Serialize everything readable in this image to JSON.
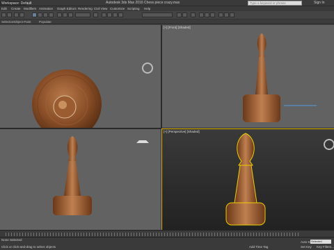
{
  "titlebar": {
    "workspace": "Workspace: Default",
    "app_title": "Autodesk 3ds Max 2016",
    "file": "Chess piece crazy.max",
    "search_placeholder": "Type a keyword or phrase",
    "signin": "Sign In"
  },
  "menus": [
    "Edit",
    "Create",
    "Modifiers",
    "Animation",
    "Graph Editors",
    "Rendering",
    "Civil View",
    "Customize",
    "Scripting",
    "Help"
  ],
  "ribbon": [
    "Selection",
    "Object Paint",
    "Populate"
  ],
  "viewports": {
    "top": "",
    "front": "[+] [Front] [Shaded]",
    "left": "",
    "perspective": "[+] [Perspective] [Shaded]"
  },
  "status": {
    "selected": "None Selected",
    "hint": "Click or click-and-drag to select objects",
    "welcome": "Welcome to M",
    "add_time_tag": "Add Time Tag",
    "set_key": "Set Key",
    "key_filters": "Key Filters...",
    "auto_key": "Auto Key",
    "selected_dd": "Selected"
  },
  "timeline": {
    "marks": [
      "0",
      "10",
      "20",
      "30",
      "40",
      "50",
      "60",
      "70",
      "80",
      "90",
      "100"
    ]
  }
}
